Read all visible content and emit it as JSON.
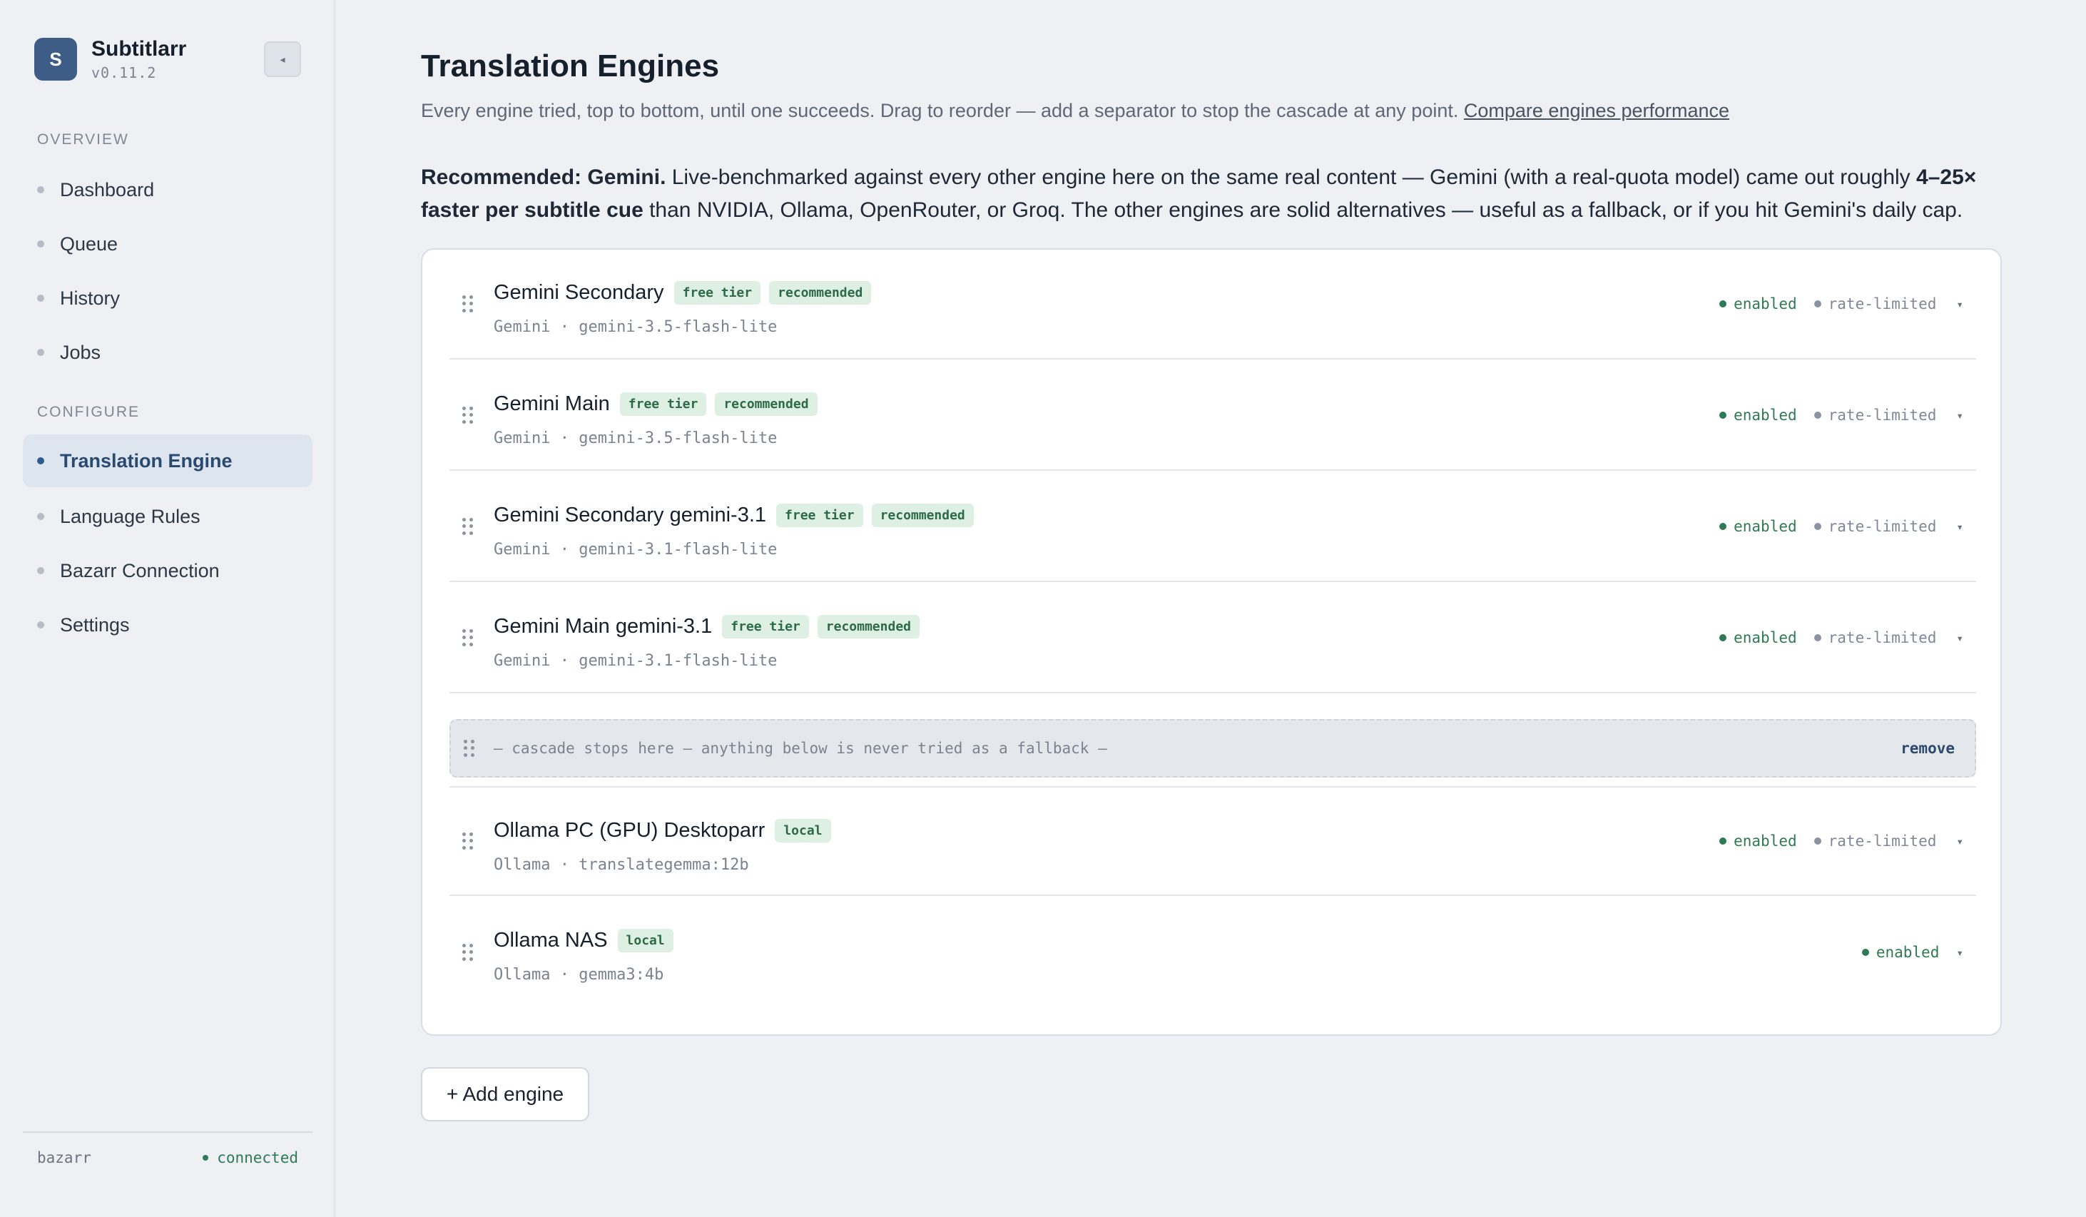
{
  "brand": {
    "logo_letter": "S",
    "name": "Subtitlarr",
    "version": "v0.11.2"
  },
  "sidebar": {
    "collapse_icon": "◂",
    "sections": [
      {
        "label": "OVERVIEW"
      },
      {
        "label": "CONFIGURE"
      }
    ],
    "items": [
      {
        "label": "Dashboard"
      },
      {
        "label": "Queue"
      },
      {
        "label": "History"
      },
      {
        "label": "Jobs"
      },
      {
        "label": "Translation Engine",
        "active": true
      },
      {
        "label": "Language Rules"
      },
      {
        "label": "Bazarr Connection"
      },
      {
        "label": "Settings"
      }
    ],
    "footer": {
      "service": "bazarr",
      "status": "connected"
    }
  },
  "main": {
    "title": "Translation Engines",
    "subtitle": "Every engine tried, top to bottom, until one succeeds. Drag to reorder — add a separator to stop the cascade at any point.",
    "subtitle_link": "Compare engines performance",
    "recommend": {
      "lead": "Recommended: Gemini.",
      "text1": " Live-benchmarked against every other engine here on the same real content — Gemini (with a real-quota model) came out roughly ",
      "bold2": "4–25× faster per subtitle cue",
      "text2": " than NVIDIA, Ollama, OpenRouter, or Groq. The other engines are solid alternatives — useful as a fallback, or if you hit Gemini's daily cap."
    },
    "engines": [
      {
        "name": "Gemini Secondary",
        "badges": [
          "free tier",
          "recommended"
        ],
        "meta": "Gemini · gemini-3.5-flash-lite",
        "enabled": "enabled",
        "rate": "rate-limited"
      },
      {
        "name": "Gemini Main",
        "badges": [
          "free tier",
          "recommended"
        ],
        "meta": "Gemini · gemini-3.5-flash-lite",
        "enabled": "enabled",
        "rate": "rate-limited"
      },
      {
        "name": "Gemini Secondary gemini-3.1",
        "badges": [
          "free tier",
          "recommended"
        ],
        "meta": "Gemini · gemini-3.1-flash-lite",
        "enabled": "enabled",
        "rate": "rate-limited"
      },
      {
        "name": "Gemini Main gemini-3.1",
        "badges": [
          "free tier",
          "recommended"
        ],
        "meta": "Gemini · gemini-3.1-flash-lite",
        "enabled": "enabled",
        "rate": "rate-limited"
      },
      {
        "name": "Ollama PC (GPU) Desktoparr",
        "badges": [
          "local"
        ],
        "meta": "Ollama · translategemma:12b",
        "enabled": "enabled",
        "rate": "rate-limited"
      },
      {
        "name": "Ollama NAS",
        "badges": [
          "local"
        ],
        "meta": "Ollama · gemma3:4b",
        "enabled": "enabled",
        "rate": null
      }
    ],
    "separator": {
      "text": "— cascade stops here — anything below is never tried as a fallback —",
      "remove": "remove"
    },
    "chevron": "▾",
    "add_button": "+ Add engine"
  }
}
